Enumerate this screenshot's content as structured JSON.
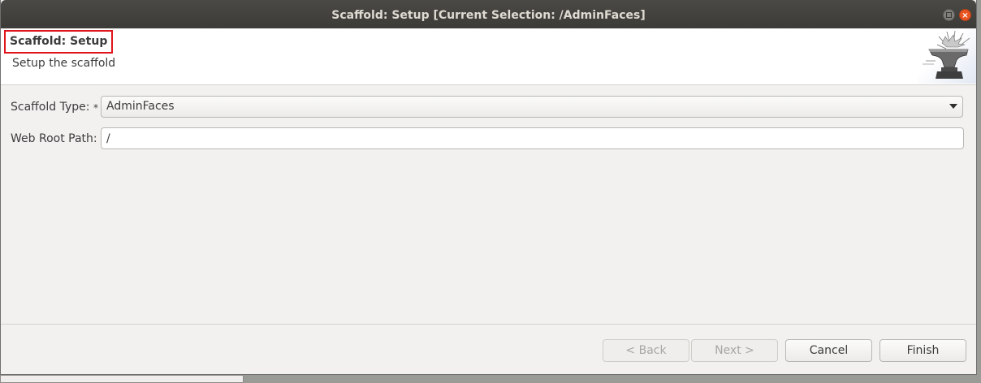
{
  "window": {
    "title": "Scaffold: Setup [Current Selection: /AdminFaces]",
    "close_glyph": "×"
  },
  "header": {
    "title": "Scaffold: Setup",
    "description": "Setup the scaffold",
    "icon": "anvil-icon"
  },
  "form": {
    "scaffold_type_label": "Scaffold Type:",
    "required_marker": "*",
    "scaffold_type_value": "AdminFaces",
    "web_root_label": "Web Root Path:",
    "web_root_value": "/"
  },
  "buttons": {
    "back": "< Back",
    "next": "Next >",
    "cancel": "Cancel",
    "finish": "Finish"
  },
  "colors": {
    "titlebar": "#3c3b37",
    "close_button": "#e95420",
    "highlight_box": "#e0141a",
    "dialog_bg": "#f2f1f0"
  }
}
